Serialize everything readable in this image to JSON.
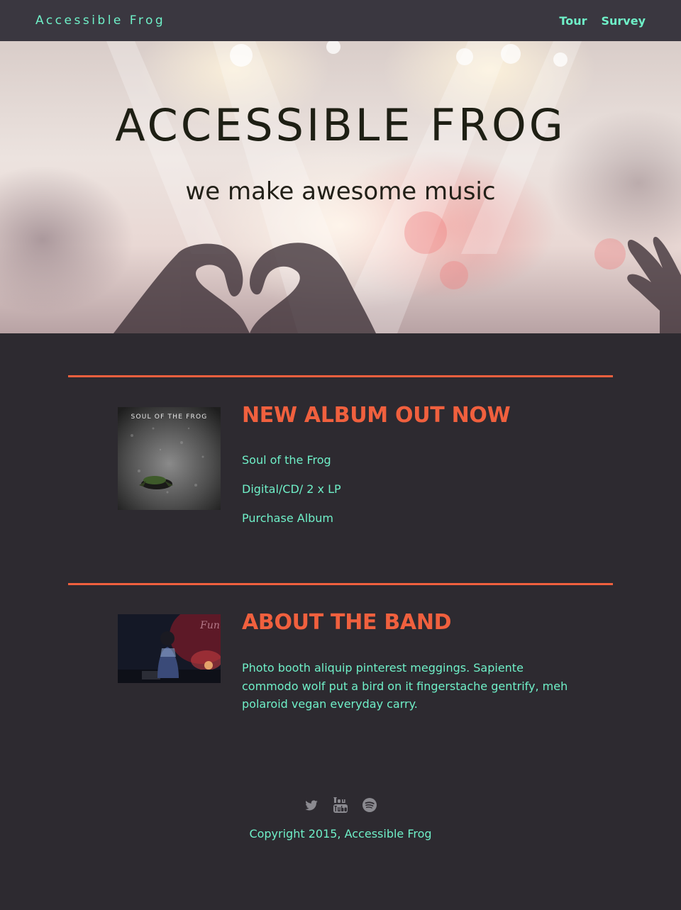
{
  "nav": {
    "brand": "Accessible Frog",
    "links": [
      "Tour",
      "Survey"
    ]
  },
  "hero": {
    "title": "ACCESSIBLE FROG",
    "subtitle": "we make awesome music"
  },
  "album": {
    "heading": "NEW ALBUM OUT NOW",
    "cover_text": "SOUL OF THE FROG",
    "name": "Soul of the Frog",
    "formats": "Digital/CD/ 2 x LP",
    "purchase": "Purchase Album"
  },
  "about": {
    "heading": "ABOUT THE BAND",
    "text": "Photo booth aliquip pinterest meggings. Sapiente commodo wolf put a bird on it fingerstache gentrify, meh polaroid vegan everyday carry."
  },
  "footer": {
    "social": [
      "twitter-icon",
      "youtube-icon",
      "spotify-icon"
    ],
    "copyright": "Copyright 2015, Accessible Frog"
  },
  "colors": {
    "background": "#2d2a30",
    "navbar": "#3a3740",
    "accent": "#f0603e",
    "text": "#6ff0c8",
    "icon": "#8b8a90"
  }
}
